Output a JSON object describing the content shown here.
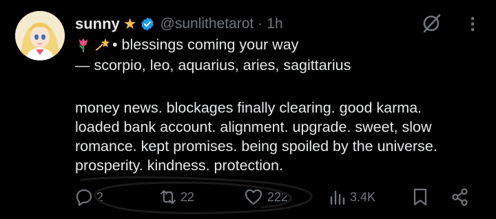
{
  "author": {
    "name": "sunny",
    "handle": "@sunlithetarot",
    "separator": "·",
    "time": "1h",
    "name_emoji": "star-emoji",
    "verified_icon": "verified-badge-icon"
  },
  "post": {
    "line1_emojis": [
      "tulip-emoji",
      "dizzy-emoji"
    ],
    "line1_text": "• blessings coming your way",
    "line2": "— scorpio, leo, aquarius, aries, sagittarius",
    "line3": "money news. blockages finally clearing. good karma.",
    "line4": "loaded bank account. alignment. upgrade. sweet, slow",
    "line5": "romance. kept promises. being spoiled by the universe.",
    "line6": "prosperity. kindness. protection."
  },
  "actions": {
    "reply_count": "2",
    "repost_count": "22",
    "like_count": "222",
    "view_count": "3.4K"
  },
  "colors": {
    "background": "#000000",
    "text": "#e7e9ea",
    "muted": "#71767b",
    "verified": "#1d9bf0"
  }
}
